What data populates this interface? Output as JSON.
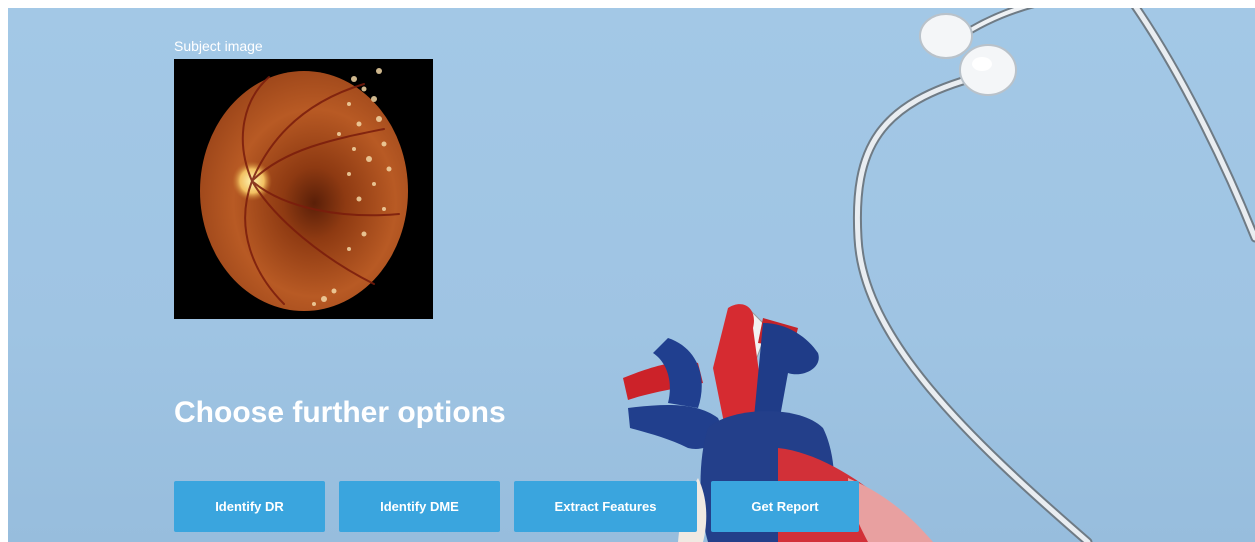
{
  "subject": {
    "label": "Subject image",
    "image_alt": "retinal fundus image"
  },
  "options": {
    "heading": "Choose further options"
  },
  "buttons": {
    "identify_dr": "Identify DR",
    "identify_dme": "Identify DME",
    "extract_features": "Extract Features",
    "get_report": "Get Report"
  },
  "colors": {
    "background": "#a3c8e6",
    "button": "#3aa5de",
    "text": "#ffffff"
  },
  "icons": [
    "stethoscope-illustration",
    "heart-model-illustration"
  ]
}
